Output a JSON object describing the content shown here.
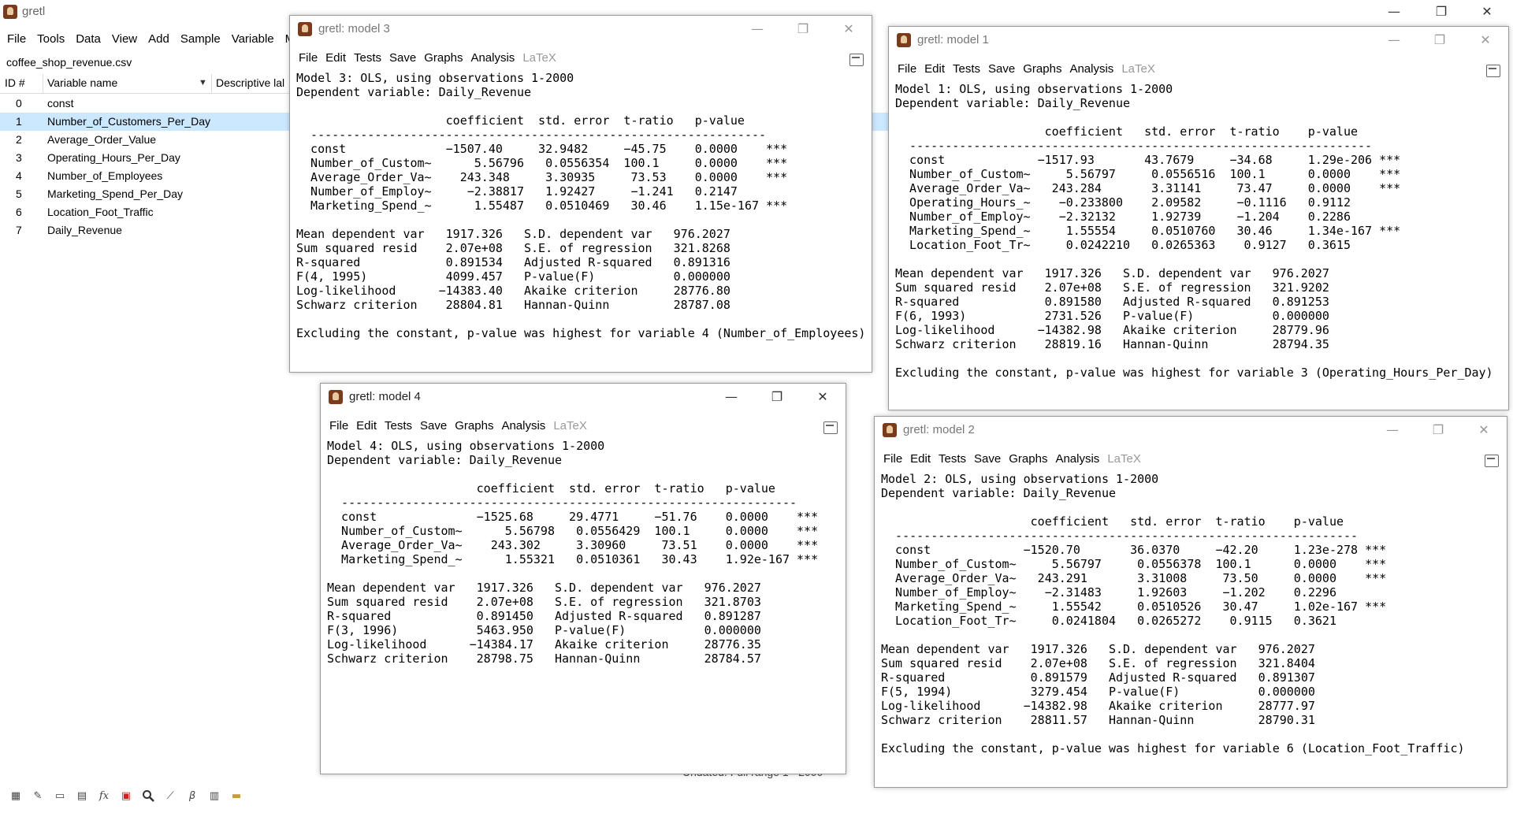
{
  "main": {
    "title": "gretl",
    "menu": [
      "File",
      "Tools",
      "Data",
      "View",
      "Add",
      "Sample",
      "Variable",
      "Mode"
    ],
    "filename": "coffee_shop_revenue.csv",
    "columns": {
      "id": "ID #",
      "name": "Variable name",
      "desc": "Descriptive lal"
    },
    "variables": [
      {
        "id": "0",
        "name": "const"
      },
      {
        "id": "1",
        "name": "Number_of_Customers_Per_Day"
      },
      {
        "id": "2",
        "name": "Average_Order_Value"
      },
      {
        "id": "3",
        "name": "Operating_Hours_Per_Day"
      },
      {
        "id": "4",
        "name": "Number_of_Employees"
      },
      {
        "id": "5",
        "name": "Marketing_Spend_Per_Day"
      },
      {
        "id": "6",
        "name": "Location_Foot_Traffic"
      },
      {
        "id": "7",
        "name": "Daily_Revenue"
      }
    ],
    "selected_variable_index": 1,
    "status_partial": "Undated: Full range 1 - 2000",
    "window_controls": {
      "minimize": "—",
      "restore": "❐",
      "close": "✕"
    },
    "toolbar_icons": [
      "calculator-icon",
      "edit-icon",
      "terminal-icon",
      "table-icon",
      "function-icon",
      "data-icon",
      "search-icon",
      "plot-icon",
      "beta-icon",
      "database-icon",
      "folder-icon"
    ],
    "toolbar_glyphs": [
      "▦",
      "✎",
      "▭",
      "▤",
      "fx",
      "▣",
      "🔍",
      "⟋",
      "β",
      "▥",
      "▬"
    ]
  },
  "model_menu": [
    "File",
    "Edit",
    "Tests",
    "Save",
    "Graphs",
    "Analysis",
    "LaTeX"
  ],
  "models": {
    "m3": {
      "title": "gretl: model 3",
      "output": "Model 3: OLS, using observations 1-2000\nDependent variable: Daily_Revenue\n\n                     coefficient  std. error  t-ratio   p-value\n  ----------------------------------------------------------------\n  const              −1507.40     32.9482     −45.75    0.0000    ***\n  Number_of_Custom~      5.56796   0.0556354  100.1     0.0000    ***\n  Average_Order_Va~    243.348     3.30935     73.53    0.0000    ***\n  Number_of_Employ~     −2.38817   1.92427     −1.241   0.2147\n  Marketing_Spend_~      1.55487   0.0510469   30.46    1.15e-167 ***\n\nMean dependent var   1917.326   S.D. dependent var   976.2027\nSum squared resid    2.07e+08   S.E. of regression   321.8268\nR-squared            0.891534   Adjusted R-squared   0.891316\nF(4, 1995)           4099.457   P-value(F)           0.000000\nLog-likelihood      −14383.40   Akaike criterion     28776.80\nSchwarz criterion    28804.81   Hannan-Quinn         28787.08\n\nExcluding the constant, p-value was highest for variable 4 (Number_of_Employees)"
    },
    "m1": {
      "title": "gretl: model 1",
      "output": "Model 1: OLS, using observations 1-2000\nDependent variable: Daily_Revenue\n\n                     coefficient   std. error  t-ratio    p-value\n  -----------------------------------------------------------------\n  const             −1517.93       43.7679     −34.68     1.29e-206 ***\n  Number_of_Custom~     5.56797     0.0556516  100.1      0.0000    ***\n  Average_Order_Va~   243.284       3.31141     73.47     0.0000    ***\n  Operating_Hours_~    −0.233800    2.09582     −0.1116   0.9112\n  Number_of_Employ~    −2.32132     1.92739     −1.204    0.2286\n  Marketing_Spend_~     1.55554     0.0510760   30.46     1.34e-167 ***\n  Location_Foot_Tr~     0.0242210   0.0265363    0.9127   0.3615\n\nMean dependent var   1917.326   S.D. dependent var   976.2027\nSum squared resid    2.07e+08   S.E. of regression   321.9202\nR-squared            0.891580   Adjusted R-squared   0.891253\nF(6, 1993)           2731.526   P-value(F)           0.000000\nLog-likelihood      −14382.98   Akaike criterion     28779.96\nSchwarz criterion    28819.16   Hannan-Quinn         28794.35\n\nExcluding the constant, p-value was highest for variable 3 (Operating_Hours_Per_Day)"
    },
    "m4": {
      "title": "gretl: model 4",
      "output": "Model 4: OLS, using observations 1-2000\nDependent variable: Daily_Revenue\n\n                     coefficient  std. error  t-ratio   p-value\n  ----------------------------------------------------------------\n  const              −1525.68     29.4771     −51.76    0.0000    ***\n  Number_of_Custom~      5.56798   0.0556429  100.1     0.0000    ***\n  Average_Order_Va~    243.302     3.30960     73.51    0.0000    ***\n  Marketing_Spend_~      1.55321   0.0510361   30.43    1.92e-167 ***\n\nMean dependent var   1917.326   S.D. dependent var   976.2027\nSum squared resid    2.07e+08   S.E. of regression   321.8703\nR-squared            0.891450   Adjusted R-squared   0.891287\nF(3, 1996)           5463.950   P-value(F)           0.000000\nLog-likelihood      −14384.17   Akaike criterion     28776.35\nSchwarz criterion    28798.75   Hannan-Quinn         28784.57"
    },
    "m2": {
      "title": "gretl: model 2",
      "output": "Model 2: OLS, using observations 1-2000\nDependent variable: Daily_Revenue\n\n                     coefficient   std. error  t-ratio    p-value\n  -----------------------------------------------------------------\n  const             −1520.70       36.0370     −42.20     1.23e-278 ***\n  Number_of_Custom~     5.56797     0.0556378  100.1      0.0000    ***\n  Average_Order_Va~   243.291       3.31008     73.50     0.0000    ***\n  Number_of_Employ~    −2.31483     1.92603     −1.202    0.2296\n  Marketing_Spend_~     1.55542     0.0510526   30.47     1.02e-167 ***\n  Location_Foot_Tr~     0.0241804   0.0265272    0.9115   0.3621\n\nMean dependent var   1917.326   S.D. dependent var   976.2027\nSum squared resid    2.07e+08   S.E. of regression   321.8404\nR-squared            0.891579   Adjusted R-squared   0.891307\nF(5, 1994)           3279.454   P-value(F)           0.000000\nLog-likelihood      −14382.98   Akaike criterion     28777.97\nSchwarz criterion    28811.57   Hannan-Quinn         28790.31\n\nExcluding the constant, p-value was highest for variable 6 (Location_Foot_Traffic)"
    }
  }
}
